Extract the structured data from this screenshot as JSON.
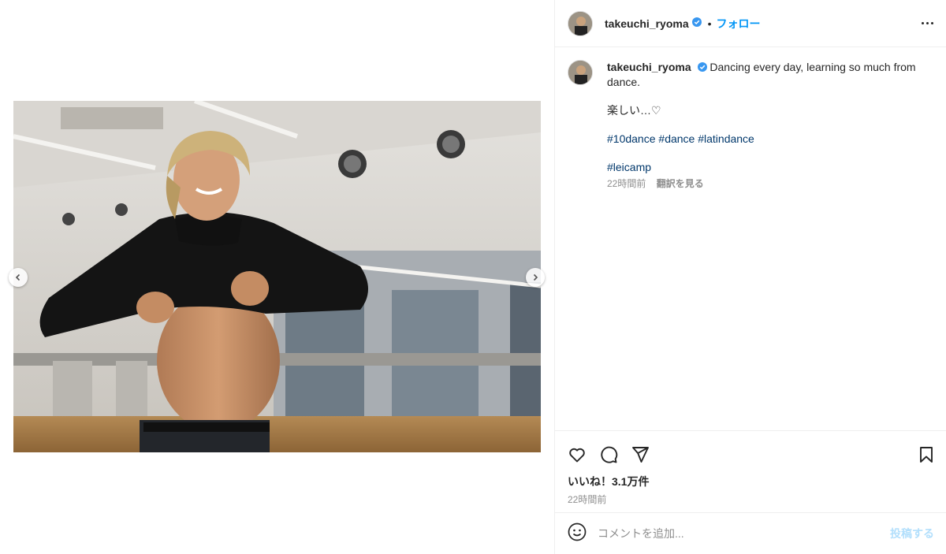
{
  "account": {
    "username": "takeuchi_ryoma",
    "separator": "•",
    "follow_label": "フォロー"
  },
  "caption": {
    "username": "takeuchi_ryoma",
    "text": "Dancing every day, learning so much from dance.",
    "line2": "楽しい…♡",
    "hashtags_line1": [
      "#10dance",
      "#dance",
      "#latindance"
    ],
    "hashtags_line2": [
      "#leicamp"
    ],
    "time": "22時間前",
    "translate_label": "翻訳を見る"
  },
  "engagement": {
    "likes": "いいね！3.1万件",
    "posted": "22時間前"
  },
  "comment_box": {
    "placeholder": "コメントを追加...",
    "post_label": "投稿する"
  },
  "colors": {
    "link": "#0095f6",
    "hashtag": "#00376b",
    "muted": "#8e8e8e",
    "post_disabled": "#b2dffc",
    "verified": "#3897f0"
  },
  "icons": [
    "verified-icon",
    "more-options-icon",
    "heart-icon",
    "comment-icon",
    "share-icon",
    "bookmark-icon",
    "emoji-icon",
    "chevron-left-icon",
    "chevron-right-icon"
  ]
}
